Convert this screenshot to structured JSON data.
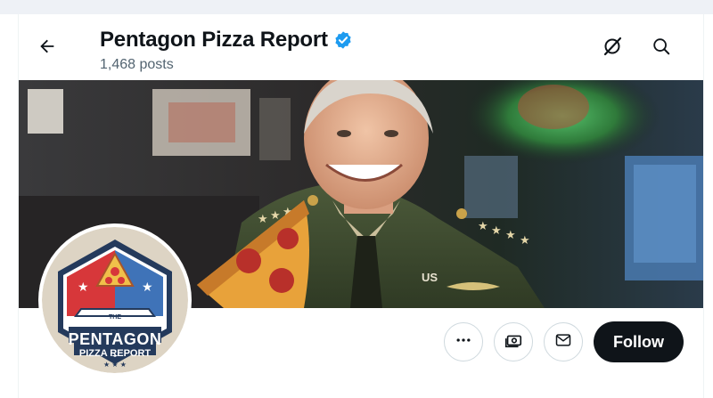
{
  "header": {
    "title": "Pentagon Pizza Report",
    "post_count": "1,468 posts",
    "verified_color": "#1d9bf0",
    "back_icon": "arrow-left-icon",
    "grok_icon": "grok-icon",
    "search_icon": "search-icon"
  },
  "banner": {
    "patch_label": "US"
  },
  "avatar": {
    "logo_line_the": "THE",
    "logo_line_1": "PENTAGON",
    "logo_line_2": "PIZZA REPORT",
    "logo_stars": "★ ★ ★",
    "colors": {
      "red": "#d7373a",
      "blue": "#3f73b8",
      "navy": "#243a5c",
      "ring": "#ddd4c4"
    }
  },
  "actions": {
    "more_icon": "more-horizontal-icon",
    "subscribe_icon": "subscribe-money-icon",
    "message_icon": "envelope-icon",
    "follow_label": "Follow"
  }
}
